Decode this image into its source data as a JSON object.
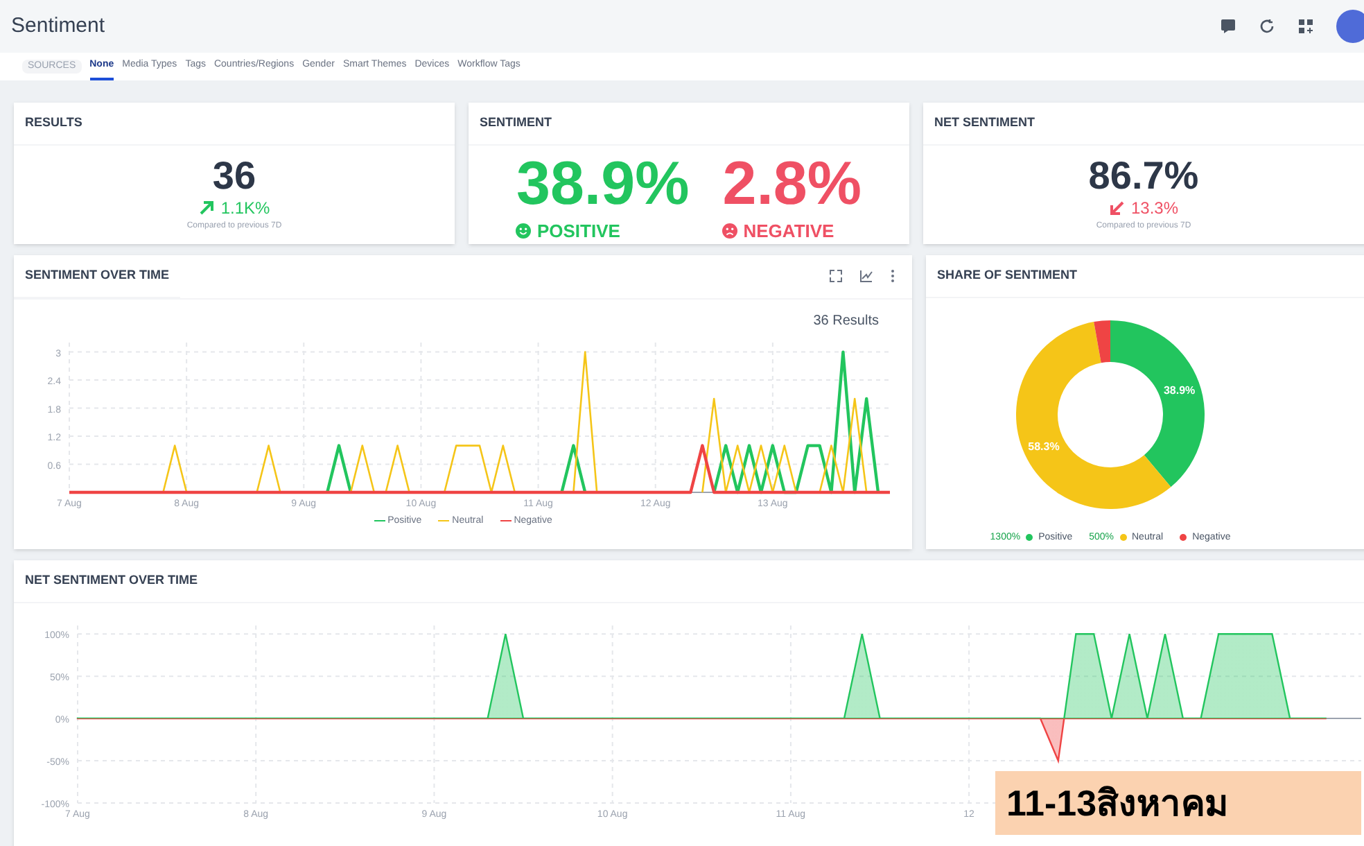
{
  "header": {
    "title": "Sentiment"
  },
  "tabs": [
    {
      "label": "SOURCES",
      "kind": "chip",
      "selected": false
    },
    {
      "label": "None",
      "kind": "tab",
      "selected": true
    },
    {
      "label": "Media Types",
      "kind": "tab",
      "selected": false
    },
    {
      "label": "Tags",
      "kind": "tab",
      "selected": false
    },
    {
      "label": "Countries/Regions",
      "kind": "tab",
      "selected": false
    },
    {
      "label": "Gender",
      "kind": "tab",
      "selected": false
    },
    {
      "label": "Smart Themes",
      "kind": "tab",
      "selected": false
    },
    {
      "label": "Devices",
      "kind": "tab",
      "selected": false
    },
    {
      "label": "Workflow Tags",
      "kind": "tab",
      "selected": false
    }
  ],
  "results": {
    "title": "RESULTS",
    "value": "36",
    "change": "1.1K%",
    "rising": true,
    "note": "Compared to previous 7D"
  },
  "sentiment": {
    "title": "SENTIMENT",
    "positive": {
      "value": "38.9%",
      "label": "POSITIVE"
    },
    "negative": {
      "value": "2.8%",
      "label": "NEGATIVE"
    }
  },
  "net_sentiment": {
    "title": "NET SENTIMENT",
    "value": "86.7%",
    "change": "13.3%",
    "rising": false,
    "note": "Compared to previous 7D"
  },
  "sentiment_over_time": {
    "title": "SENTIMENT OVER TIME",
    "results_label": "36 Results",
    "chart_data": {
      "type": "line",
      "categories": [
        "7 Aug",
        null,
        null,
        null,
        null,
        null,
        null,
        null,
        null,
        null,
        "8 Aug",
        null,
        null,
        null,
        null,
        null,
        null,
        null,
        null,
        null,
        "9 Aug",
        null,
        null,
        null,
        null,
        null,
        null,
        null,
        null,
        null,
        "10 Aug",
        null,
        null,
        null,
        null,
        null,
        null,
        null,
        null,
        null,
        "11 Aug",
        null,
        null,
        null,
        null,
        null,
        null,
        null,
        null,
        null,
        "12 Aug",
        null,
        null,
        null,
        null,
        null,
        null,
        null,
        null,
        null,
        "13 Aug",
        null,
        null,
        null,
        null,
        null,
        null,
        null,
        null,
        null,
        null
      ],
      "series": [
        {
          "name": "Positive",
          "color": "#22c55e",
          "values": [
            null,
            null,
            null,
            null,
            null,
            null,
            null,
            null,
            null,
            null,
            null,
            null,
            null,
            null,
            null,
            null,
            null,
            null,
            null,
            null,
            null,
            null,
            0,
            1,
            0,
            null,
            null,
            null,
            null,
            null,
            null,
            null,
            null,
            null,
            null,
            null,
            null,
            null,
            null,
            null,
            null,
            null,
            0,
            1,
            0,
            null,
            null,
            null,
            null,
            null,
            null,
            null,
            null,
            null,
            null,
            0,
            1,
            0,
            1,
            0,
            1,
            0,
            0,
            1,
            1,
            0,
            3,
            0,
            2,
            0,
            null
          ]
        },
        {
          "name": "Neutral",
          "color": "#f5c518",
          "values": [
            null,
            null,
            null,
            null,
            null,
            null,
            null,
            null,
            0,
            1,
            0,
            null,
            null,
            null,
            null,
            null,
            0,
            1,
            0,
            null,
            null,
            null,
            null,
            null,
            0,
            1,
            0,
            0,
            1,
            0,
            null,
            null,
            0,
            1,
            1,
            1,
            0,
            1,
            0,
            null,
            null,
            null,
            null,
            0,
            3,
            0,
            null,
            null,
            null,
            null,
            null,
            null,
            null,
            null,
            0,
            2,
            0,
            1,
            0,
            1,
            0,
            1,
            0,
            null,
            0,
            1,
            0,
            2,
            0,
            null,
            null
          ]
        },
        {
          "name": "Negative",
          "color": "#ef4444",
          "values": [
            0,
            0,
            0,
            0,
            0,
            0,
            0,
            0,
            0,
            0,
            0,
            0,
            0,
            0,
            0,
            0,
            0,
            0,
            0,
            0,
            0,
            0,
            0,
            0,
            0,
            0,
            0,
            0,
            0,
            0,
            0,
            0,
            0,
            0,
            0,
            0,
            0,
            0,
            0,
            0,
            0,
            0,
            0,
            0,
            0,
            0,
            0,
            0,
            0,
            0,
            0,
            0,
            0,
            0,
            1,
            0,
            0,
            0,
            0,
            0,
            0,
            0,
            0,
            0,
            0,
            0,
            0,
            0,
            0,
            0,
            0
          ]
        }
      ],
      "ylim": [
        0,
        3.2
      ],
      "grid": true,
      "yticks": [
        0.6,
        1.2,
        1.8,
        2.4,
        3
      ]
    }
  },
  "share_of_sentiment": {
    "title": "SHARE OF SENTIMENT",
    "chart_data": {
      "type": "donut",
      "categories": [
        "Positive",
        "Neutral",
        "Negative"
      ],
      "values": [
        38.9,
        58.3,
        2.8
      ],
      "colors": [
        "#22c55e",
        "#f5c518",
        "#ef4444"
      ]
    },
    "slice_labels": [
      "38.9%",
      "58.3%"
    ],
    "legend": [
      {
        "change": "1300%",
        "color": "#22c55e"
      },
      {
        "change": "500%",
        "color": "#f5c518"
      },
      {
        "color": "#ef4444"
      }
    ]
  },
  "net_sentiment_over_time": {
    "title": "NET SENTIMENT OVER TIME",
    "chart_data": {
      "type": "area",
      "categories": [
        "7 Aug",
        null,
        null,
        null,
        null,
        null,
        null,
        null,
        null,
        null,
        "8 Aug",
        null,
        null,
        null,
        null,
        null,
        null,
        null,
        null,
        null,
        "9 Aug",
        null,
        null,
        null,
        null,
        null,
        null,
        null,
        null,
        null,
        "10 Aug",
        null,
        null,
        null,
        null,
        null,
        null,
        null,
        null,
        null,
        "11 Aug",
        null,
        null,
        null,
        null,
        null,
        null,
        null,
        null,
        null,
        "12",
        null,
        null,
        null,
        null,
        null,
        null,
        null,
        null,
        null,
        null,
        null,
        null,
        null,
        null,
        null,
        null,
        null,
        null,
        null,
        null
      ],
      "series": [
        {
          "color": "#22c55e",
          "values": [
            0,
            0,
            0,
            0,
            0,
            0,
            0,
            0,
            0,
            0,
            0,
            0,
            0,
            0,
            0,
            0,
            0,
            0,
            0,
            0,
            0,
            0,
            0,
            0,
            100,
            0,
            0,
            0,
            0,
            0,
            0,
            0,
            0,
            0,
            0,
            0,
            0,
            0,
            0,
            0,
            0,
            0,
            0,
            0,
            100,
            0,
            0,
            0,
            0,
            0,
            0,
            0,
            0,
            0,
            0,
            -50,
            100,
            100,
            0,
            100,
            0,
            100,
            0,
            0,
            100,
            100,
            100,
            100,
            0,
            0,
            0
          ]
        }
      ],
      "ylim": [
        -100,
        110
      ],
      "grid": true,
      "yticks": [
        {
          "value": 100,
          "label": "100%"
        },
        {
          "value": 50,
          "label": "50%"
        },
        {
          "value": 0,
          "label": "0%"
        },
        {
          "value": -50,
          "label": "-50%"
        },
        {
          "value": -100,
          "label": "-100%"
        }
      ]
    }
  },
  "overlay_note": {
    "text": "11-13สิงหาคม"
  }
}
